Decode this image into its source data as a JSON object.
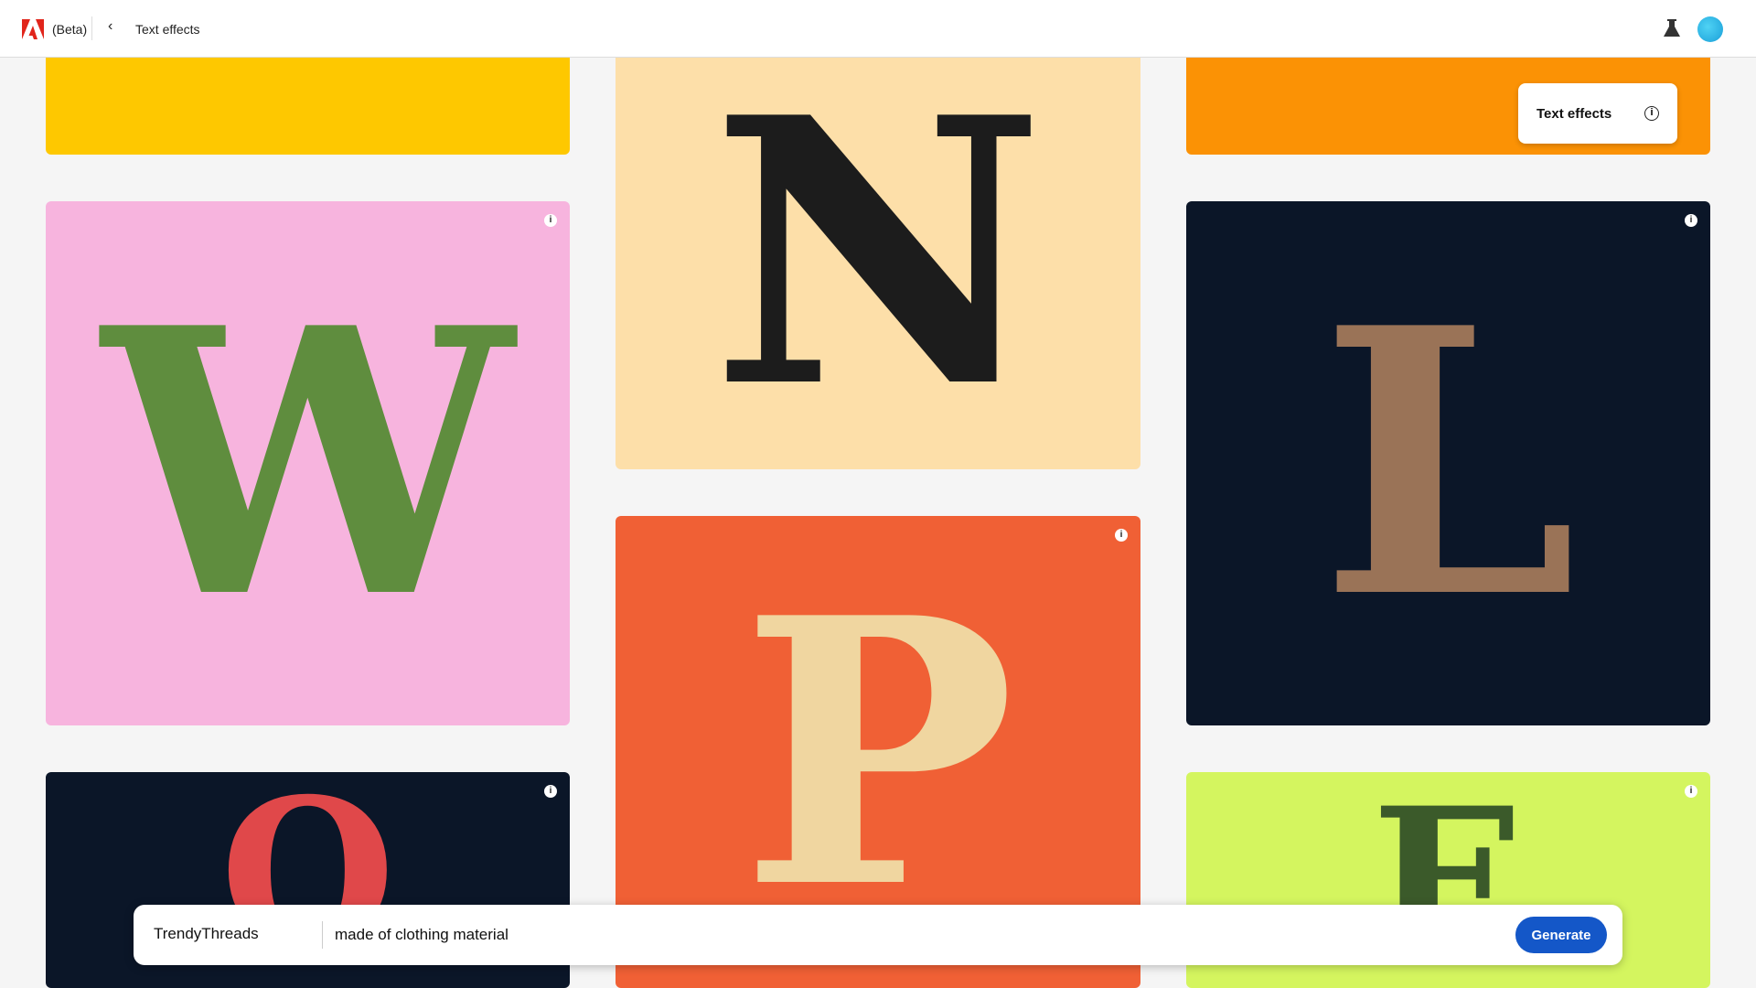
{
  "header": {
    "beta_label": "(Beta)",
    "breadcrumb": "Text effects"
  },
  "tooltip": {
    "label": "Text effects"
  },
  "cards": [
    {
      "letter": "",
      "bg": "#fec800"
    },
    {
      "letter": "W",
      "bg": "#f7b4de",
      "color": "#5f8d3e"
    },
    {
      "letter": "O",
      "bg": "#0b1628",
      "color": "#e0484a"
    },
    {
      "letter": "N",
      "bg": "#fddfa9",
      "color": "#1c1c1c"
    },
    {
      "letter": "P",
      "bg": "#f06035",
      "color": "#f0d6a0"
    },
    {
      "letter": "",
      "bg": "#fb9205"
    },
    {
      "letter": "L",
      "bg": "#0b1628",
      "color": "#9a7357"
    },
    {
      "letter": "E",
      "bg": "#d4f55f",
      "color": "#3b5a2a"
    }
  ],
  "prompt": {
    "font": "TrendyThreads",
    "text": "made of clothing material",
    "generate_label": "Generate"
  },
  "colors": {
    "accent": "#1457c8"
  }
}
